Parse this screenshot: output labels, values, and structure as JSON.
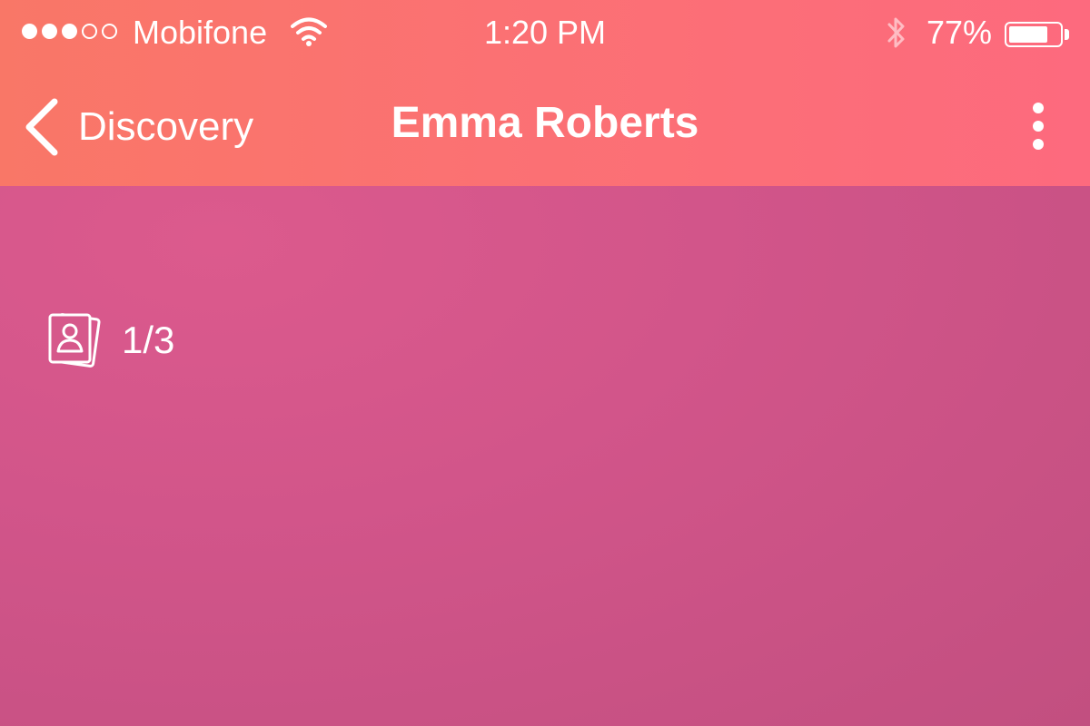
{
  "status_bar": {
    "carrier": "Mobifone",
    "time": "1:20 PM",
    "battery_percent": "77%",
    "signal_bars_filled": 3,
    "signal_bars_total": 5,
    "battery_level": 0.77,
    "icons": [
      "wifi-icon",
      "bluetooth-icon",
      "battery-icon"
    ]
  },
  "nav": {
    "back_label": "Discovery",
    "title": "Emma Roberts",
    "icons": [
      "chevron-left-icon",
      "more-vertical-icon"
    ]
  },
  "photo": {
    "counter": "1/3",
    "counter_icon": "photo-gallery-icon"
  },
  "colors": {
    "header_gradient_start": "#f97767",
    "header_gradient_end": "#fd6a7e",
    "photo_background": "#d2558a"
  }
}
